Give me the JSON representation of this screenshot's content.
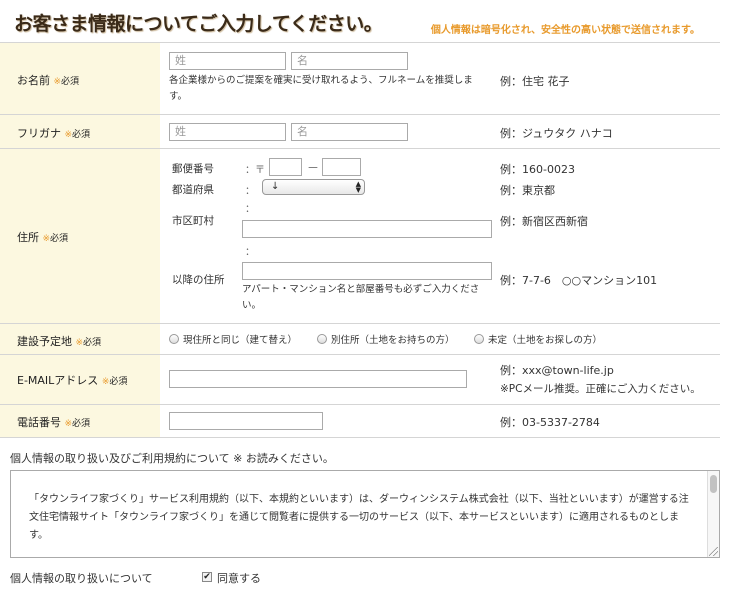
{
  "header": {
    "title": "お客さま情報についてご入力してください。",
    "subtitle": "個人情報は暗号化され、安全性の高い状態で送信されます。"
  },
  "required": {
    "mark": "※",
    "word": "必須"
  },
  "name": {
    "label": "お名前",
    "last_placeholder": "姓",
    "first_placeholder": "名",
    "note": "各企業様からのご提案を確実に受け取れるよう、フルネームを推奨します。",
    "example": "例：住宅 花子"
  },
  "furigana": {
    "label": "フリガナ",
    "last_placeholder": "姓",
    "first_placeholder": "名",
    "example": "例：ジュウタク ハナコ"
  },
  "address": {
    "label": "住所",
    "postal_label": "郵便番号",
    "postal_prefix": "：〒",
    "postal_dash": "－",
    "prefecture_label": "都道府県",
    "prefecture_selected": "↓",
    "city_label": "市区町村",
    "after_label": "以降の住所",
    "colon": "：",
    "after_note": "アパート・マンション名と部屋番号も必ずご入力ください。",
    "postal_example": "例：160-0023",
    "prefecture_example": "例：東京都",
    "city_example": "例：新宿区西新宿",
    "after_example": "例：7-7-6　○○マンション101"
  },
  "build_site": {
    "label": "建設予定地",
    "options": [
      "現住所と同じ（建て替え）",
      "別住所（土地をお持ちの方）",
      "未定（土地をお探しの方）"
    ]
  },
  "email": {
    "label": "E-MAILアドレス",
    "example": "例：xxx@town-life.jp",
    "example_note": "※PCメール推奨。正確にご入力ください。"
  },
  "phone": {
    "label": "電話番号",
    "example": "例：03-5337-2784"
  },
  "policy": {
    "intro": "個人情報の取り扱い及びご利用規約について ※ お読みください。",
    "text": "「タウンライフ家づくり」サービス利用規約（以下、本規約といいます）は、ダーウィンシステム株式会社（以下、当社といいます）が運営する注文住宅情報サイト「タウンライフ家づくり」を通じて閲覧者に提供する一切のサービス（以下、本サービスといいます）に適用されるものとします。"
  },
  "agree": {
    "label": "個人情報の取り扱いについて",
    "checkbox_mark": "✔",
    "text": "同意する"
  }
}
